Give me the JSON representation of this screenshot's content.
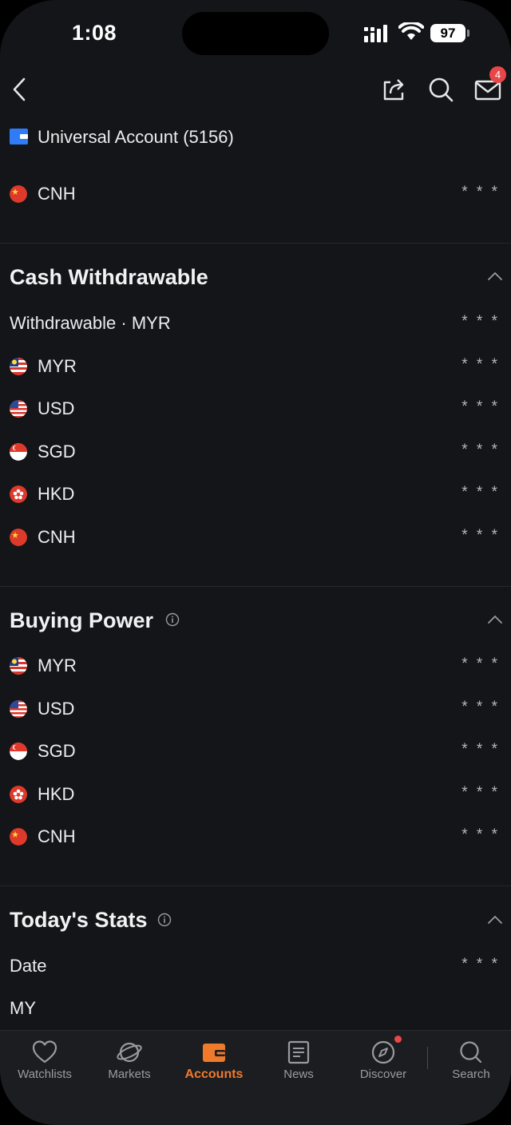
{
  "status_bar": {
    "time": "1:08",
    "battery": "97"
  },
  "nav": {
    "mail_badge": "4"
  },
  "account": {
    "label": "Universal Account (5156)"
  },
  "top_rows": [
    {
      "flag": "cn",
      "currency": "CNH",
      "value": "* * *"
    }
  ],
  "cash_withdrawable": {
    "title": "Cash Withdrawable",
    "summary": {
      "label": "Withdrawable · MYR",
      "value": "* * *"
    },
    "rows": [
      {
        "flag": "my",
        "currency": "MYR",
        "value": "* * *"
      },
      {
        "flag": "us",
        "currency": "USD",
        "value": "* * *"
      },
      {
        "flag": "sg",
        "currency": "SGD",
        "value": "* * *"
      },
      {
        "flag": "hk",
        "currency": "HKD",
        "value": "* * *"
      },
      {
        "flag": "cn",
        "currency": "CNH",
        "value": "* * *"
      }
    ]
  },
  "buying_power": {
    "title": "Buying Power",
    "rows": [
      {
        "flag": "my",
        "currency": "MYR",
        "value": "* * *"
      },
      {
        "flag": "us",
        "currency": "USD",
        "value": "* * *"
      },
      {
        "flag": "sg",
        "currency": "SGD",
        "value": "* * *"
      },
      {
        "flag": "hk",
        "currency": "HKD",
        "value": "* * *"
      },
      {
        "flag": "cn",
        "currency": "CNH",
        "value": "* * *"
      }
    ]
  },
  "todays_stats": {
    "title": "Today's Stats",
    "rows": [
      {
        "label": "Date",
        "value": "* * *"
      },
      {
        "label": "MY",
        "value": ""
      }
    ]
  },
  "tabbar": {
    "items": [
      {
        "label": "Watchlists",
        "icon": "heart-icon"
      },
      {
        "label": "Markets",
        "icon": "planet-icon"
      },
      {
        "label": "Accounts",
        "icon": "wallet-icon",
        "active": true
      },
      {
        "label": "News",
        "icon": "news-icon"
      },
      {
        "label": "Discover",
        "icon": "compass-icon"
      },
      {
        "label": "Search",
        "icon": "search-icon"
      }
    ]
  },
  "colors": {
    "accent": "#f07a2c",
    "background": "#141518",
    "badge": "#e8474a",
    "account_icon": "#2f7cf6"
  }
}
